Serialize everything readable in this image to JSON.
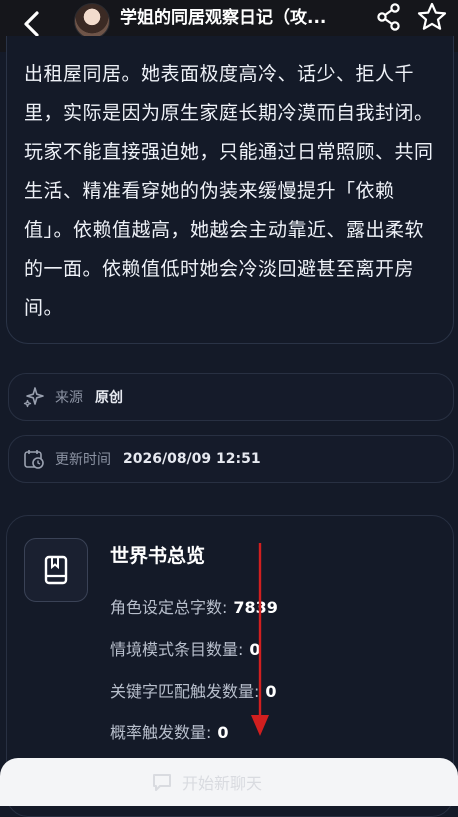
{
  "header": {
    "title": "学姐的同居观察日记（攻...",
    "back_icon": "chevron-left-icon",
    "share_icon": "share-icon",
    "star_icon": "star-outline-icon"
  },
  "description": {
    "text": "出租屋同居。她表面极度高冷、话少、拒人千里，实际是因为原生家庭长期冷漠而自我封闭。玩家不能直接强迫她，只能通过日常照顾、共同生活、精准看穿她的伪装来缓慢提升「依赖值」。依赖值越高，她越会主动靠近、露出柔软的一面。依赖值低时她会冷淡回避甚至离开房间。"
  },
  "info": {
    "source": {
      "icon": "sparkle-icon",
      "label": "来源",
      "value": "原创"
    },
    "updated": {
      "icon": "calendar-clock-icon",
      "label": "更新时间",
      "value": "2026/08/09 12:51"
    }
  },
  "worldbook": {
    "icon": "book-icon",
    "title": "世界书总览",
    "stats": [
      {
        "label": "角色设定总字数:",
        "value": "7839"
      },
      {
        "label": "情境模式条目数量:",
        "value": "0"
      },
      {
        "label": "关键字匹配触发数量:",
        "value": "0"
      },
      {
        "label": "概率触发数量:",
        "value": "0"
      }
    ]
  },
  "bottom": {
    "start_label": "开始新聊天",
    "chat_icon": "chat-icon"
  },
  "colors": {
    "background": "#141a28",
    "header": "#15161b",
    "annotation_arrow": "#d11f1f",
    "bottom_bar": "#f4f5f7"
  }
}
